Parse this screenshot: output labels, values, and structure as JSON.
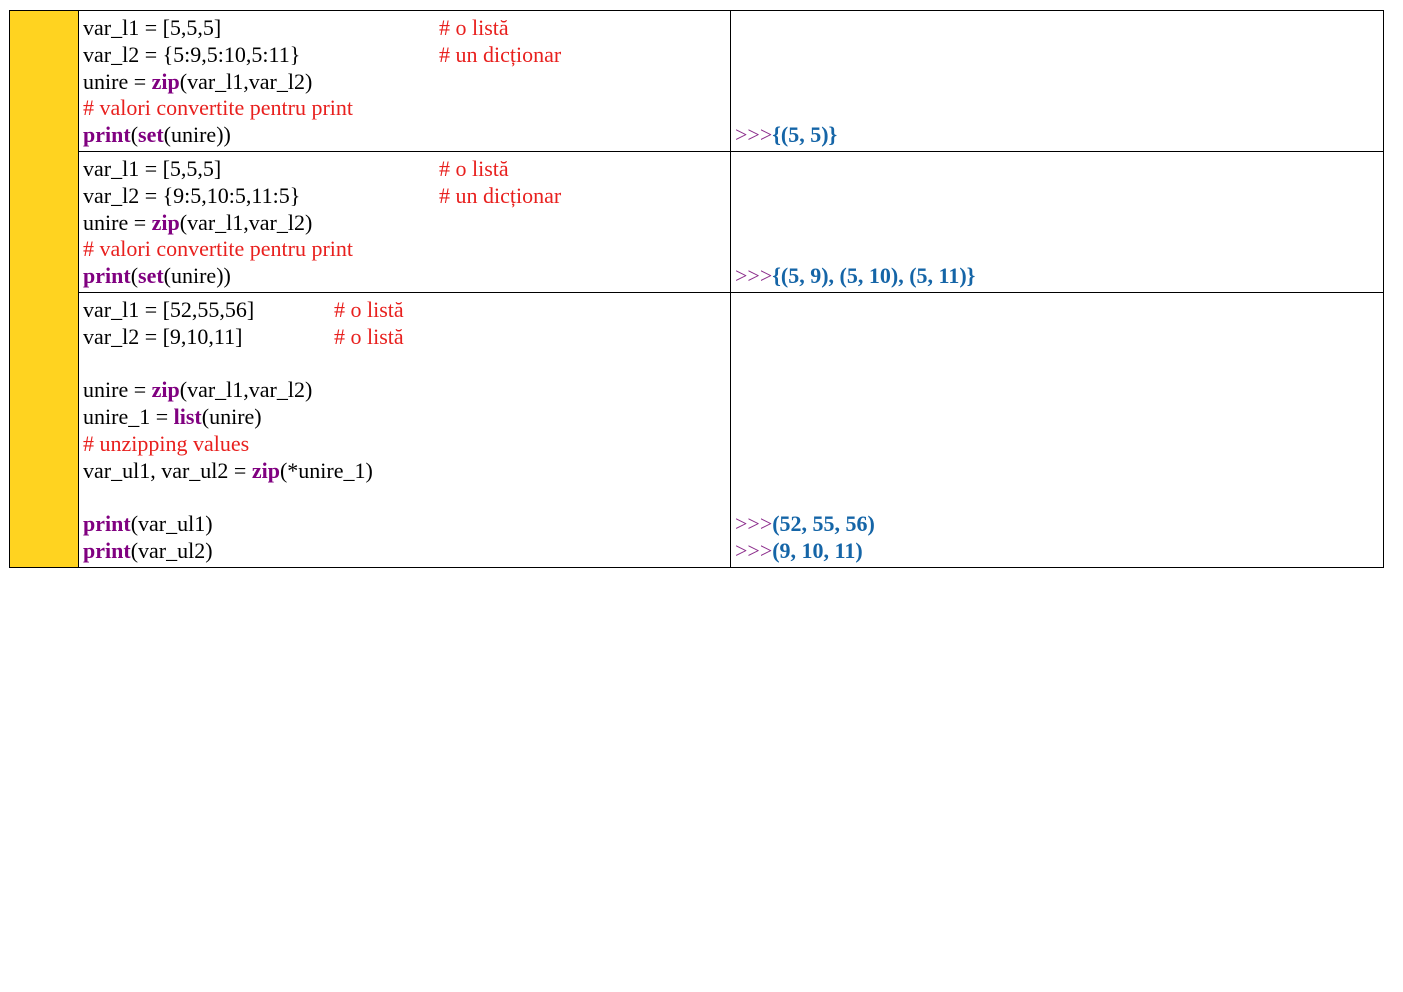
{
  "colors": {
    "side_bar": "#ffd320",
    "comment": "#e8201e",
    "keyword": "#800080",
    "prompt": "#8b2c8b",
    "result": "#1565a7"
  },
  "rows": [
    {
      "code": [
        {
          "parts": [
            {
              "t": "var_l1 = [5,5,5]",
              "c": "plain"
            }
          ],
          "comment": "# o listă"
        },
        {
          "parts": [
            {
              "t": "var_l2 = {5:9,5:10,5:11}",
              "c": "plain"
            }
          ],
          "comment": "# un dicționar"
        },
        {
          "parts": [
            {
              "t": "unire = ",
              "c": "plain"
            },
            {
              "t": "zip",
              "c": "kw"
            },
            {
              "t": "(var_l1,var_l2)",
              "c": "plain"
            }
          ]
        },
        {
          "parts": [
            {
              "t": "# valori convertite pentru print",
              "c": "comment"
            }
          ]
        },
        {
          "parts": [
            {
              "t": "print",
              "c": "kw"
            },
            {
              "t": "(",
              "c": "plain"
            },
            {
              "t": "set",
              "c": "kw"
            },
            {
              "t": "(unire))",
              "c": "plain"
            }
          ]
        }
      ],
      "output": [
        {
          "prompt": ">>>",
          "value": "{(5, 5)}"
        }
      ]
    },
    {
      "code": [
        {
          "parts": [
            {
              "t": "var_l1 = [5,5,5]",
              "c": "plain"
            }
          ],
          "comment": "# o listă"
        },
        {
          "parts": [
            {
              "t": "var_l2 = {9:5,10:5,11:5}",
              "c": "plain"
            }
          ],
          "comment": "# un dicționar"
        },
        {
          "parts": [
            {
              "t": "unire = ",
              "c": "plain"
            },
            {
              "t": "zip",
              "c": "kw"
            },
            {
              "t": "(var_l1,var_l2)",
              "c": "plain"
            }
          ]
        },
        {
          "parts": [
            {
              "t": "# valori convertite pentru print",
              "c": "comment"
            }
          ]
        },
        {
          "parts": [
            {
              "t": "print",
              "c": "kw"
            },
            {
              "t": "(",
              "c": "plain"
            },
            {
              "t": "set",
              "c": "kw"
            },
            {
              "t": "(unire))",
              "c": "plain"
            }
          ]
        }
      ],
      "output": [
        {
          "prompt": ">>>",
          "value": "{(5, 9), (5, 10), (5, 11)}"
        }
      ]
    },
    {
      "code": [
        {
          "parts": [
            {
              "t": "var_l1 = [52,55,56]",
              "c": "plain"
            }
          ],
          "comment": "# o listă"
        },
        {
          "parts": [
            {
              "t": "var_l2 = [9,10,11]",
              "c": "plain"
            }
          ],
          "comment": "# o listă"
        },
        {
          "parts": []
        },
        {
          "parts": [
            {
              "t": "unire = ",
              "c": "plain"
            },
            {
              "t": "zip",
              "c": "kw"
            },
            {
              "t": "(var_l1,var_l2)",
              "c": "plain"
            }
          ]
        },
        {
          "parts": [
            {
              "t": "unire_1 = ",
              "c": "plain"
            },
            {
              "t": "list",
              "c": "kw"
            },
            {
              "t": "(unire)",
              "c": "plain"
            }
          ]
        },
        {
          "parts": [
            {
              "t": "# unzipping values",
              "c": "comment"
            }
          ]
        },
        {
          "parts": [
            {
              "t": "var_ul1, var_ul2 = ",
              "c": "plain"
            },
            {
              "t": "zip",
              "c": "kw"
            },
            {
              "t": "(*unire_1)",
              "c": "plain"
            }
          ]
        },
        {
          "parts": []
        },
        {
          "parts": [
            {
              "t": "print",
              "c": "kw"
            },
            {
              "t": "(var_ul1)",
              "c": "plain"
            }
          ]
        },
        {
          "parts": [
            {
              "t": "print",
              "c": "kw"
            },
            {
              "t": "(var_ul2)",
              "c": "plain"
            }
          ]
        }
      ],
      "output": [
        {
          "prompt": ">>>",
          "value": "(52, 55, 56)"
        },
        {
          "prompt": ">>>",
          "value": "(9, 10, 11)"
        }
      ]
    }
  ]
}
